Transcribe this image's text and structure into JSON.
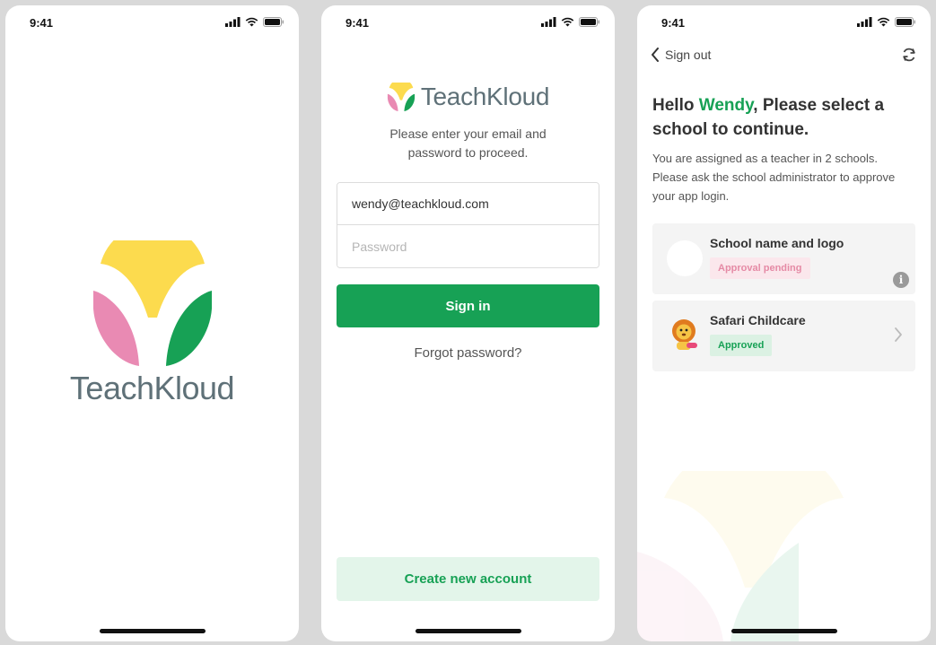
{
  "status_bar": {
    "time": "9:41"
  },
  "splash": {
    "brand": "TeachKloud"
  },
  "signin": {
    "brand": "TeachKloud",
    "subtitle": "Please enter your email and password to proceed.",
    "email_value": "wendy@teachkloud.com",
    "password_placeholder": "Password",
    "signin_label": "Sign in",
    "forgot_label": "Forgot password?",
    "create_label": "Create new account"
  },
  "schools": {
    "signout_label": "Sign out",
    "greeting_prefix": "Hello ",
    "greeting_name": "Wendy",
    "greeting_suffix": ", Please select a school to continue.",
    "assigned_text": "You are assigned as a teacher in 2 schools. Please ask the school administrator to approve your app login.",
    "cards": [
      {
        "name": "School name and logo",
        "status": "Approval pending"
      },
      {
        "name": "Safari Childcare",
        "status": "Approved"
      }
    ]
  },
  "colors": {
    "brand_green": "#17a155",
    "brand_yellow": "#fcdb4e",
    "brand_pink": "#e98ab3",
    "brand_slate": "#5f7178",
    "light_green": "#e3f5ea"
  },
  "icons": [
    "signal-icon",
    "wifi-icon",
    "battery-icon",
    "chevron-left-icon",
    "refresh-icon",
    "info-icon",
    "chevron-right-icon",
    "lion-icon"
  ]
}
